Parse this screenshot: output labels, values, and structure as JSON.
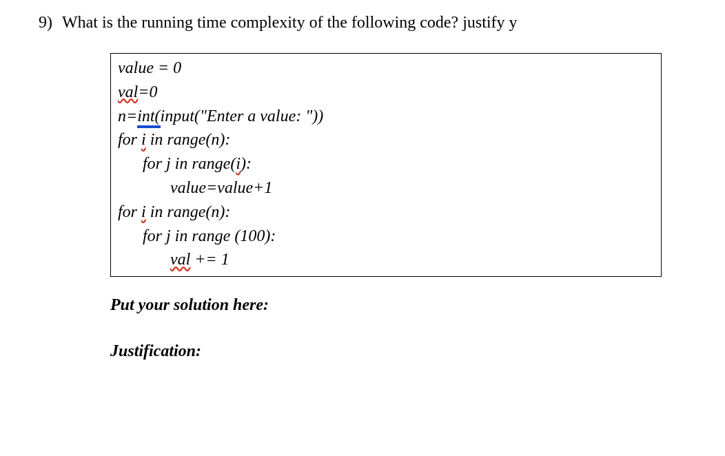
{
  "question": {
    "number": "9)",
    "text": "What is the running time complexity of the following code? justify y"
  },
  "code": {
    "l1a": "value = 0",
    "l2_val": "val",
    "l2b": "=0",
    "l3a": "n=",
    "l3_int": "int(",
    "l3b": "input(\"Enter a value: \"))",
    "l4a": "for ",
    "l4_i": "i",
    "l4b": " in range(n):",
    "l5": "for j in range(",
    "l5_i": "i",
    "l5b": "):",
    "l6": "value=value+1",
    "l7a": "for ",
    "l7_i": "i",
    "l7b": " in range(n):",
    "l8": "for j in range (100):",
    "l9_val": "val",
    "l9b": " += 1"
  },
  "prompts": {
    "solution": "Put your solution here:",
    "justification": "Justification:"
  }
}
